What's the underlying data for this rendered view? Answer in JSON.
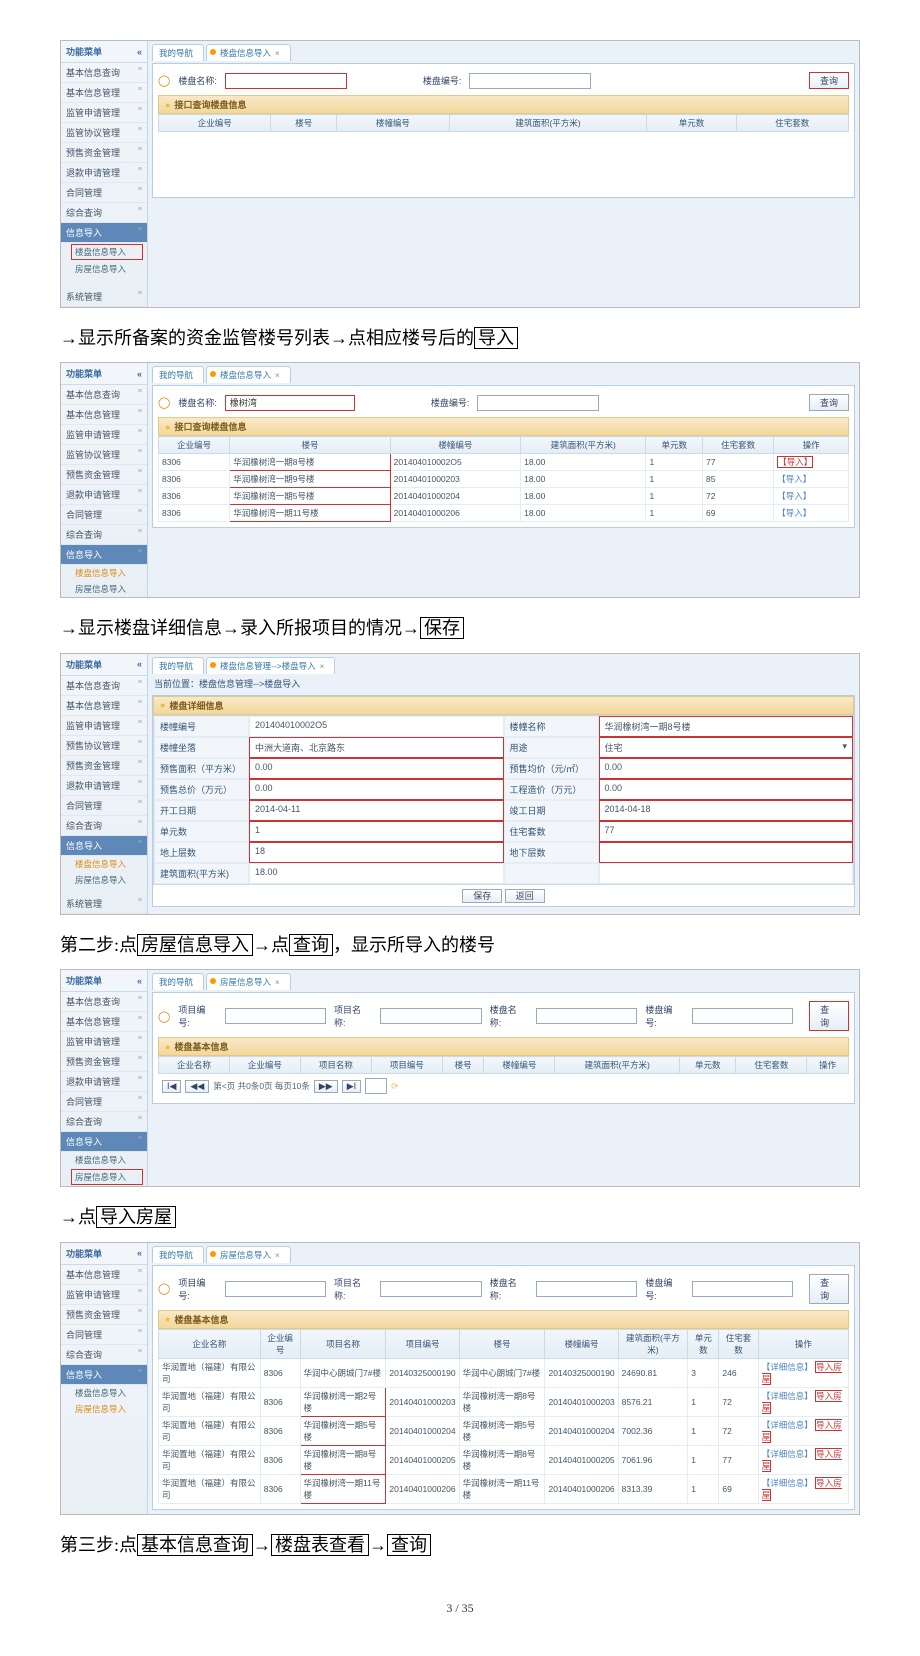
{
  "footer": "3 / 35",
  "desc": {
    "d1_pre": "→显示所备案的资金监管楼号列表→点相应楼号后的",
    "d1_box": "导入",
    "d2_pre": "→显示楼盘详细信息→录入所报项目的情况→",
    "d2_box": "保存",
    "d3_s1": "第二步:点",
    "d3_b1": "房屋信息导入",
    "d3_s2": "→点",
    "d3_b2": "查询",
    "d3_s3": "，显示所导入的楼号",
    "d4_s1": "→点",
    "d4_b1": "导入房屋",
    "d5_s1": "第三步:点",
    "d5_b1": "基本信息查询",
    "d5_s2": "→",
    "d5_b2": "楼盘表查看",
    "d5_s3": "→",
    "d5_b3": "查询"
  },
  "menu": {
    "title": "功能菜单",
    "m1": "基本信息查询",
    "m2": "基本信息管理",
    "m3": "监管申请管理",
    "m4": "监管协议管理",
    "m5": "预售资金管理",
    "m6": "退款申请管理",
    "m7": "合同管理",
    "m8": "综合查询",
    "mHL": "信息导入",
    "sub1": "楼盘信息导入",
    "sub2": "房屋信息导入",
    "sys": "系统管理",
    "m5b": "预售协议管理"
  },
  "tabs": {
    "nav": "我的导航",
    "t1": "楼盘信息导入",
    "t2": "楼盘信息管理-->楼盘导入",
    "t3": "房屋信息导入"
  },
  "labels": {
    "loupanmc": "楼盘名称:",
    "loupanbh": "楼盘编号:",
    "query": "查询",
    "group1": "接口查询楼盘信息",
    "xmbh": "项目编号:",
    "xmmc": "项目名称:",
    "group2": "楼盘基本信息",
    "pager": "第<页 共0条0页 每页10条",
    "path": "当前位置：楼盘信息管理-->楼盘导入",
    "group3": "楼盘详细信息",
    "save": "保存",
    "back": "返回"
  },
  "cols1": {
    "c1": "企业编号",
    "c2": "楼号",
    "c3": "楼幢编号",
    "c4": "建筑面积(平方米)",
    "c5": "单元数",
    "c6": "住宅套数"
  },
  "cols2": {
    "c1": "企业编号",
    "c2": "楼号",
    "c3": "楼幢编号",
    "c4": "建筑面积(平方米)",
    "c5": "单元数",
    "c6": "住宅套数",
    "c7": "操作"
  },
  "rows2": [
    {
      "c1": "8306",
      "c2": "华润橡树湾一期8号楼",
      "c3": "201404010002O5",
      "c4": "18.00",
      "c5": "1",
      "c6": "77",
      "op": "【导入】"
    },
    {
      "c1": "8306",
      "c2": "华润橡树湾一期9号楼",
      "c3": "20140401000203",
      "c4": "18.00",
      "c5": "1",
      "c6": "85",
      "op": "【导入】"
    },
    {
      "c1": "8306",
      "c2": "华润橡树湾一期5号楼",
      "c3": "20140401000204",
      "c4": "18.00",
      "c5": "1",
      "c6": "72",
      "op": "【导入】"
    },
    {
      "c1": "8306",
      "c2": "华润橡树湾一期11号楼",
      "c3": "20140401000206",
      "c4": "18.00",
      "c5": "1",
      "c6": "69",
      "op": "【导入】"
    }
  ],
  "s2_input": "橡树湾",
  "form": {
    "lzbh_l": "楼幢编号",
    "lzbh_v": "201404010002O5",
    "lzmc_l": "楼幢名称",
    "lzmc_v": "华润橡树湾一期8号楼",
    "lzzl_l": "楼幢坐落",
    "lzzl_v": "中洲大道南、北京路东",
    "yt_l": "用途",
    "yt_v": "住宅",
    "ysmj_l": "预售面积（平方米）",
    "ysmj_v": "0.00",
    "ysjj_l": "预售均价（元/㎡）",
    "ysjj_v": "0.00",
    "yszj_l": "预售总价（万元）",
    "yszj_v": "0.00",
    "gczj_l": "工程造价（万元）",
    "gczj_v": "0.00",
    "kgrq_l": "开工日期",
    "kgrq_v": "2014-04-11",
    "jgrq_l": "竣工日期",
    "jgrq_v": "2014-04-18",
    "dys_l": "单元数",
    "dys_v": "1",
    "zzts_l": "住宅套数",
    "zzts_v": "77",
    "dscs_l": "地上层数",
    "dscs_v": "18",
    "dxcs_l": "地下层数",
    "dxcs_v": "",
    "jzmj_l": "建筑面积(平方米)",
    "jzmj_v": "18.00"
  },
  "cols4": {
    "c1": "企业名称",
    "c2": "企业编号",
    "c3": "项目名称",
    "c4": "项目编号",
    "c5": "楼号",
    "c6": "楼幢编号",
    "c7": "建筑面积(平方米)",
    "c8": "单元数",
    "c9": "住宅套数",
    "c10": "操作"
  },
  "cols5": {
    "c1": "企业名称",
    "c2": "企业编号",
    "c3": "项目名称",
    "c4": "项目编号",
    "c5": "楼号",
    "c6": "楼幢编号",
    "c7": "建筑面积(平方米)",
    "c8": "单元数",
    "c9": "住宅套数",
    "c10": "操作"
  },
  "rows5": [
    {
      "q": "华润置地（福建）有限公司",
      "qb": "8306",
      "xm": "华润中心朗城门7#楼",
      "xb": "20140325000190",
      "lh": "华润中心朗城门7#楼",
      "lb": "20140325000190",
      "mj": "24690.81",
      "dy": "3",
      "ts": "246",
      "op1": "【详细信息】",
      "op2": "导入房屋"
    },
    {
      "q": "华润置地（福建）有限公司",
      "qb": "8306",
      "xm": "华润橡树湾一期2号楼",
      "xb": "20140401000203",
      "lh": "华润橡树湾一期8号楼",
      "lb": "20140401000203",
      "mj": "8576.21",
      "dy": "1",
      "ts": "72",
      "op1": "【详细信息】",
      "op2": "导入房屋"
    },
    {
      "q": "华润置地（福建）有限公司",
      "qb": "8306",
      "xm": "华润橡树湾一期5号楼",
      "xb": "20140401000204",
      "lh": "华润橡树湾一期5号楼",
      "lb": "20140401000204",
      "mj": "7002.36",
      "dy": "1",
      "ts": "72",
      "op1": "【详细信息】",
      "op2": "导入房屋"
    },
    {
      "q": "华润置地（福建）有限公司",
      "qb": "8306",
      "xm": "华润橡树湾一期8号楼",
      "xb": "20140401000205",
      "lh": "华润橡树湾一期8号楼",
      "lb": "20140401000205",
      "mj": "7061.96",
      "dy": "1",
      "ts": "77",
      "op1": "【详细信息】",
      "op2": "导入房屋"
    },
    {
      "q": "华润置地（福建）有限公司",
      "qb": "8306",
      "xm": "华润橡树湾一期11号楼",
      "xb": "20140401000206",
      "lh": "华润橡树湾一期11号楼",
      "lb": "20140401000206",
      "mj": "8313.39",
      "dy": "1",
      "ts": "69",
      "op1": "【详细信息】",
      "op2": "导入房屋"
    }
  ]
}
